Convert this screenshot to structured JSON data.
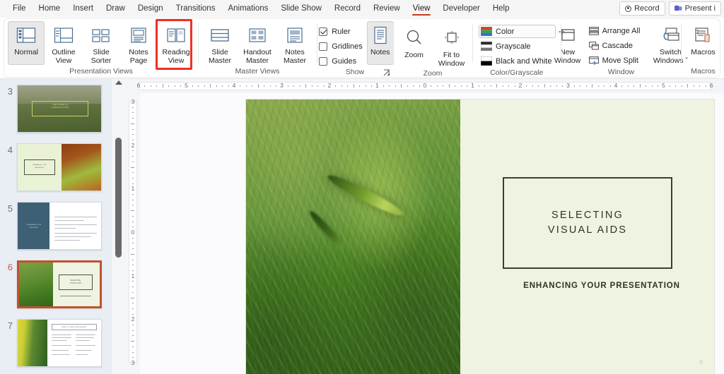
{
  "window": {
    "tabs": [
      {
        "label": "File",
        "active": false
      },
      {
        "label": "Home",
        "active": false
      },
      {
        "label": "Insert",
        "active": false
      },
      {
        "label": "Draw",
        "active": false
      },
      {
        "label": "Design",
        "active": false
      },
      {
        "label": "Transitions",
        "active": false
      },
      {
        "label": "Animations",
        "active": false
      },
      {
        "label": "Slide Show",
        "active": false
      },
      {
        "label": "Record",
        "active": false
      },
      {
        "label": "Review",
        "active": false
      },
      {
        "label": "View",
        "active": true
      },
      {
        "label": "Developer",
        "active": false
      },
      {
        "label": "Help",
        "active": false
      }
    ],
    "record_button": "Record",
    "present_button": "Present i",
    "accent_color": "#c43e1c",
    "highlight_color": "#ee3124"
  },
  "ribbon": {
    "groups": [
      {
        "name": "Presentation Views",
        "label": "Presentation Views",
        "buttons": [
          {
            "label": "Normal",
            "icon": "normal-view-icon",
            "selected": true
          },
          {
            "label": "Outline\nView",
            "icon": "outline-view-icon",
            "selected": false
          },
          {
            "label": "Slide\nSorter",
            "icon": "slide-sorter-icon",
            "selected": false
          },
          {
            "label": "Notes\nPage",
            "icon": "notes-page-icon",
            "selected": false
          },
          {
            "label": "Reading\nView",
            "icon": "reading-view-icon",
            "selected": false
          }
        ]
      },
      {
        "name": "Master Views",
        "label": "Master Views",
        "buttons": [
          {
            "label": "Slide\nMaster",
            "icon": "slide-master-icon",
            "highlighted": true
          },
          {
            "label": "Handout\nMaster",
            "icon": "handout-master-icon",
            "highlighted": false
          },
          {
            "label": "Notes\nMaster",
            "icon": "notes-master-icon",
            "highlighted": false
          }
        ]
      },
      {
        "name": "Show",
        "label": "Show",
        "checkboxes": [
          {
            "label": "Ruler",
            "checked": true
          },
          {
            "label": "Gridlines",
            "checked": false
          },
          {
            "label": "Guides",
            "checked": false
          }
        ],
        "buttons": [
          {
            "label": "Notes",
            "icon": "notes-icon",
            "selected": true
          }
        ],
        "launcher": "dialog-launcher"
      },
      {
        "name": "Zoom",
        "label": "Zoom",
        "buttons": [
          {
            "label": "Zoom",
            "icon": "magnifier-icon"
          },
          {
            "label": "Fit to\nWindow",
            "icon": "fit-to-window-icon"
          }
        ]
      },
      {
        "name": "Color/Grayscale",
        "label": "Color/Grayscale",
        "items": [
          {
            "label": "Color",
            "icon": "color-swatch-icon",
            "selected": true
          },
          {
            "label": "Grayscale",
            "icon": "grayscale-swatch-icon",
            "selected": false
          },
          {
            "label": "Black and White",
            "icon": "bw-swatch-icon",
            "selected": false
          }
        ]
      },
      {
        "name": "Window",
        "label": "Window",
        "buttons": [
          {
            "label": "New\nWindow",
            "icon": "new-window-icon"
          },
          {
            "label": "Switch\nWindows ˇ",
            "icon": "switch-windows-icon"
          }
        ],
        "items": [
          {
            "label": "Arrange All",
            "icon": "arrange-all-icon"
          },
          {
            "label": "Cascade",
            "icon": "cascade-icon"
          },
          {
            "label": "Move Split",
            "icon": "move-split-icon"
          }
        ]
      },
      {
        "name": "Macros",
        "label": "Macros",
        "buttons": [
          {
            "label": "Macros",
            "icon": "macros-icon"
          }
        ]
      }
    ]
  },
  "thumbnails": {
    "current_slide": 6,
    "items": [
      {
        "number": "3",
        "type": "title-photo",
        "title": "THE POWER OF\nCOMMUNICATION"
      },
      {
        "number": "4",
        "type": "split-right-photo",
        "title": "ENGAGING THE\nAUDIENCE"
      },
      {
        "number": "5",
        "type": "teal-sidebar-text",
        "title": "PREPARING FOR\nDELIVERY"
      },
      {
        "number": "6",
        "type": "split-left-photo",
        "title": "SELECTING\nVISUAL AIDS",
        "selected": true
      },
      {
        "number": "7",
        "type": "photo-left-two-col",
        "title": "PRACTICE AND REFINEMENT"
      }
    ]
  },
  "rulers": {
    "horizontal_labels": [
      "6",
      "5",
      "4",
      "3",
      "2",
      "1",
      "0",
      "1",
      "2",
      "3",
      "4",
      "5",
      "6"
    ],
    "vertical_labels": [
      "3",
      "2",
      "1",
      "0",
      "1",
      "2",
      "3"
    ]
  },
  "slide": {
    "title": "SELECTING\nVISUAL AIDS",
    "subtitle": "ENHANCING YOUR PRESENTATION",
    "slide_number": "6",
    "background_color": "#eef4e1",
    "text_color": "#2f3527",
    "photo_alt": "green-wheat-field-photo"
  }
}
